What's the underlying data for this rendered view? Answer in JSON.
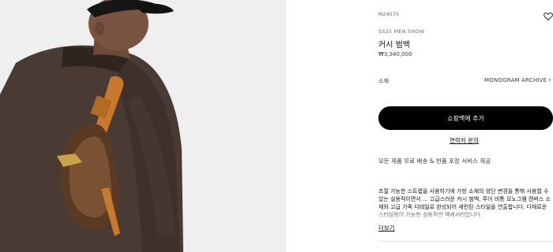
{
  "product": {
    "sku": "M24070",
    "collection": "SS25 MEN SHOW",
    "name": "커시 범백",
    "price": "₩3,340,000"
  },
  "material": {
    "label": "소재",
    "value": "MONOGRAM ARCHIVE"
  },
  "actions": {
    "add_to_cart": "쇼핑백에 추가",
    "contact": "연락처 문의",
    "more": "더보기"
  },
  "shipping_note": "모든 제품 무료 배송 & 반품 포장 서비스 제공",
  "description": "조절 가능한 스트랩을 사용하기에 가방 소재의 양단 변경을 통해 사용할 수 있는 실용적이면서 ... 고급스러운 커시 범백. 루이 비통 모노그램 캔버스 소재와 고급 가죽 디테일로 완성되어 세련된 스타일을 연출합니다. 다채로운 스타일링이 가능한 실용적인 액세서리입니다.",
  "icons": {
    "wishlist": "heart-outline-icon",
    "material_chevron": "chevron-right-icon"
  },
  "colors": {
    "button_bg": "#000000",
    "button_text": "#ffffff",
    "photo_bg": "#efefef"
  }
}
